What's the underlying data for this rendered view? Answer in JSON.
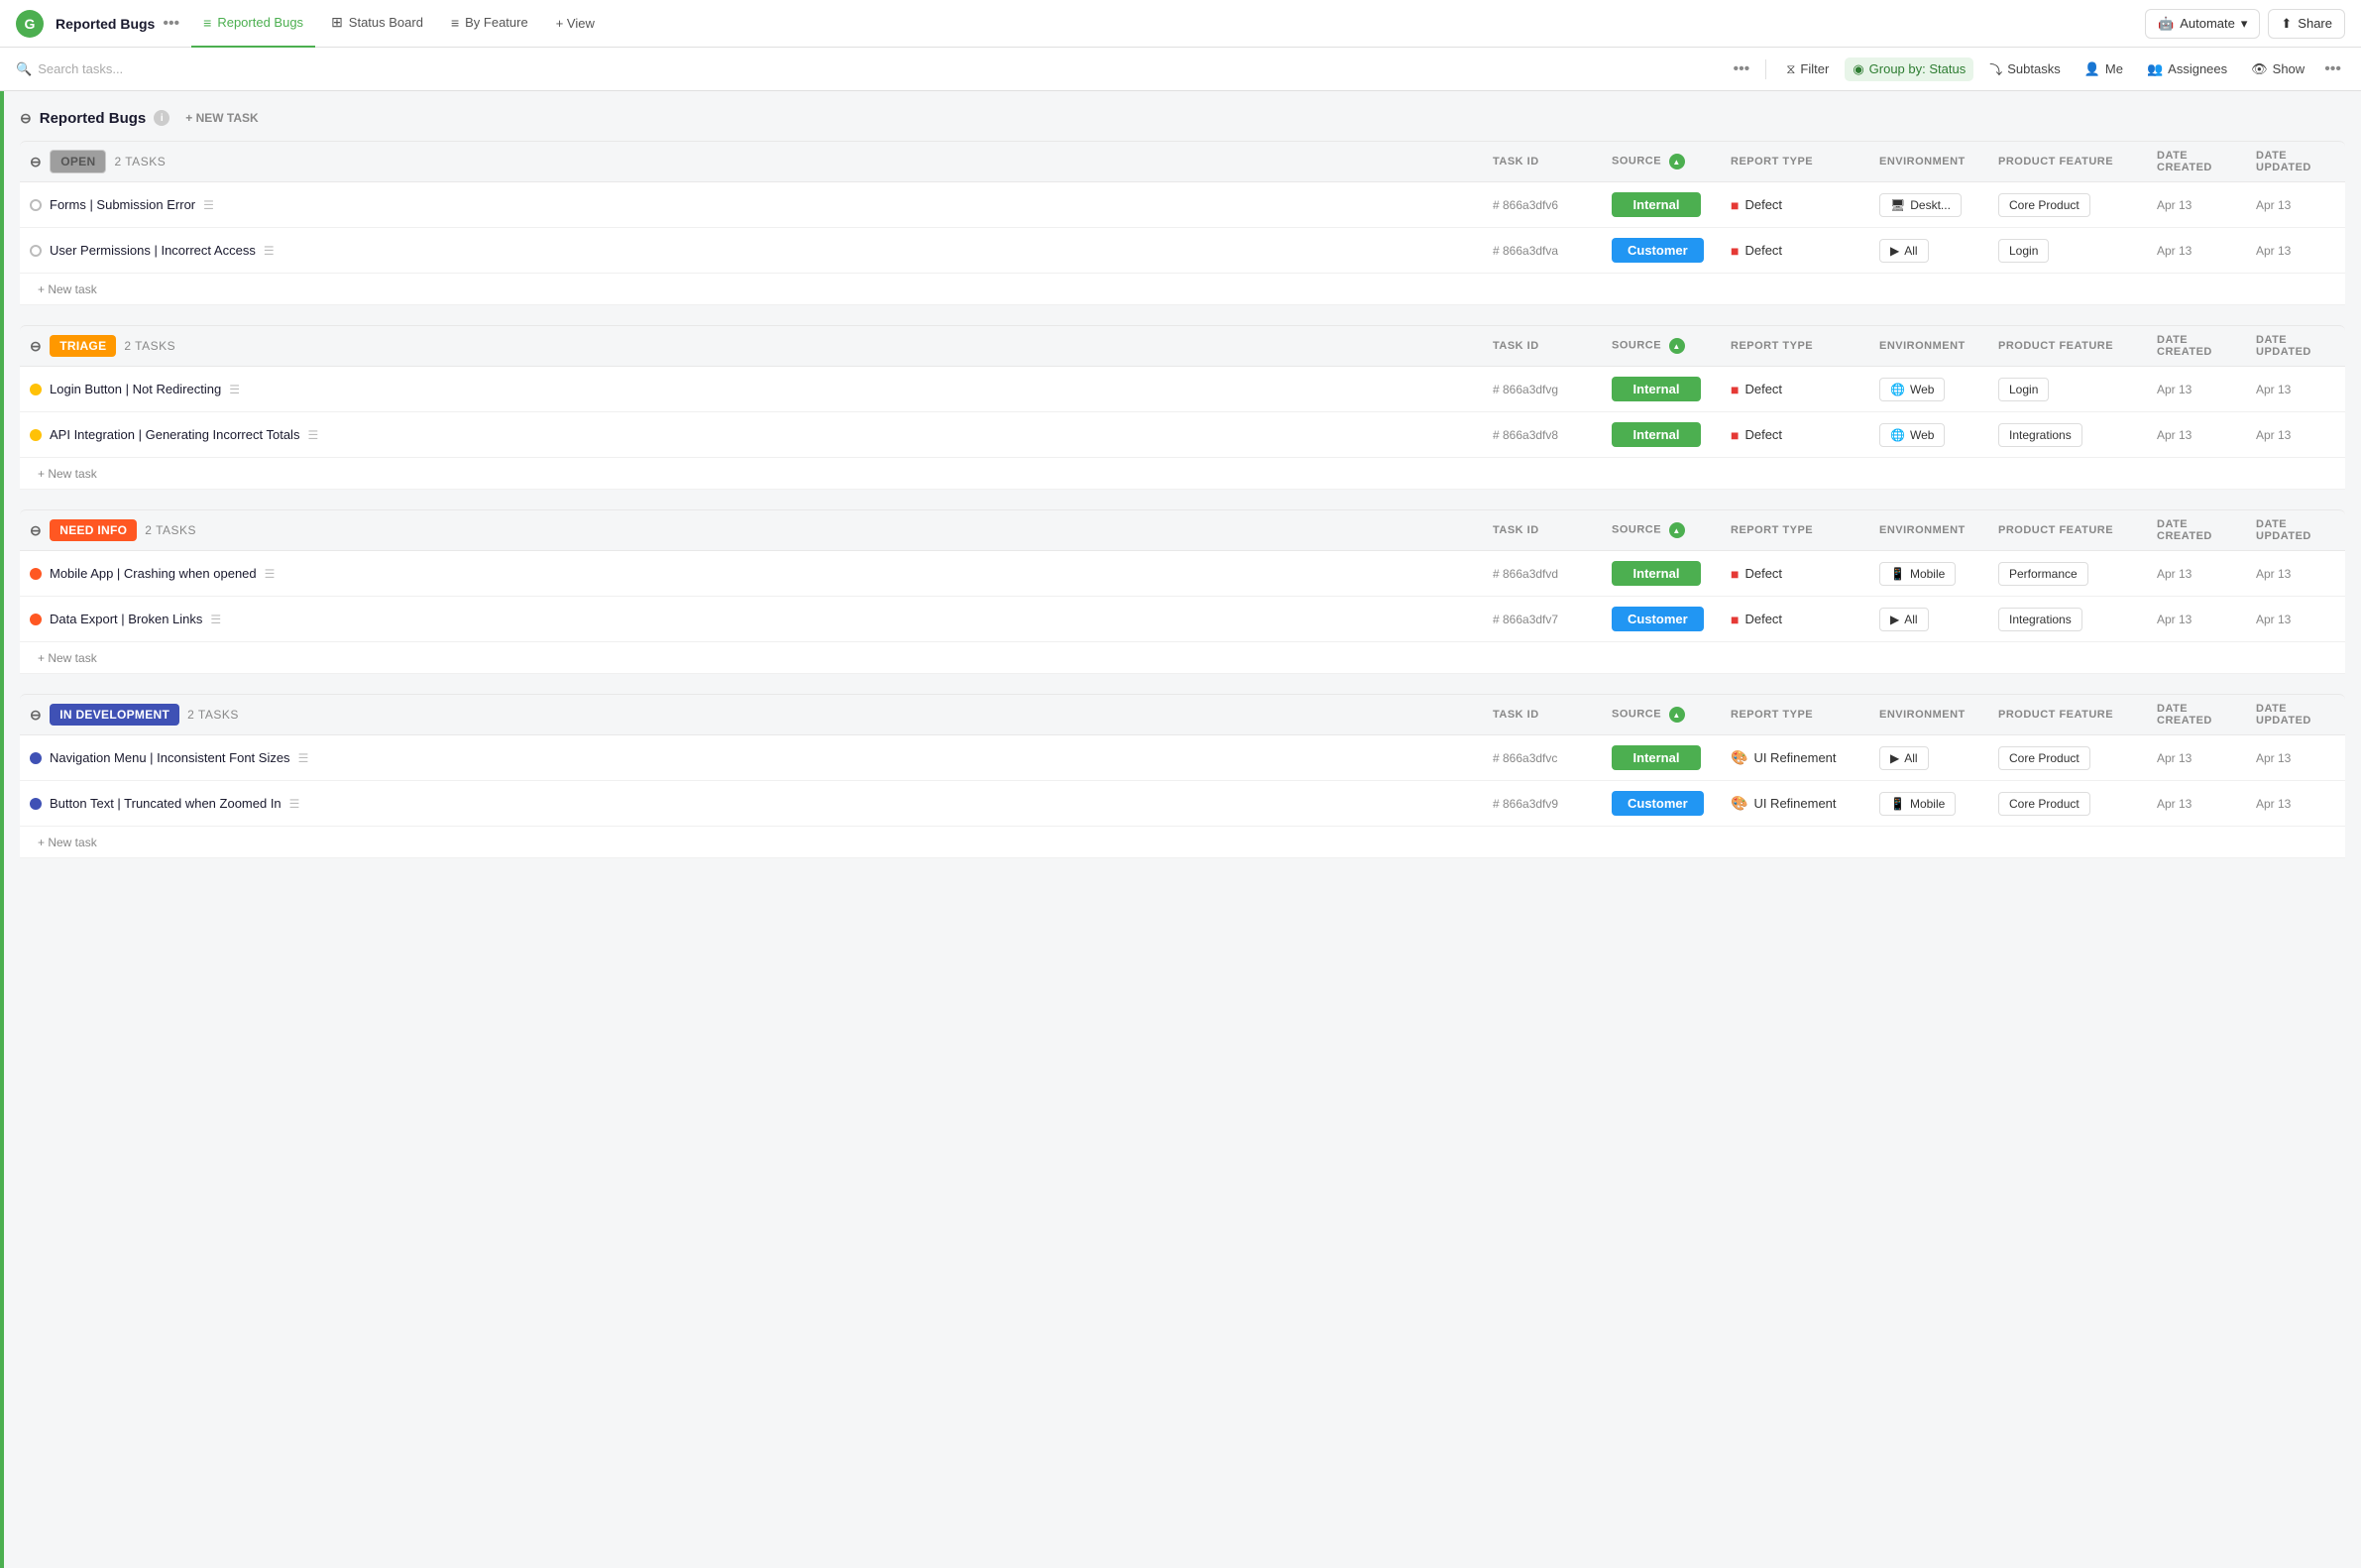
{
  "app": {
    "logo": "G",
    "title": "Reported Bugs",
    "dots_label": "•••"
  },
  "nav": {
    "tabs": [
      {
        "id": "reported-bugs",
        "icon": "≡",
        "label": "Reported Bugs",
        "active": true
      },
      {
        "id": "status-board",
        "icon": "⊞",
        "label": "Status Board",
        "active": false
      },
      {
        "id": "by-feature",
        "icon": "≡",
        "label": "By Feature",
        "active": false
      }
    ],
    "add_view": "+ View"
  },
  "actions": {
    "automate_label": "Automate",
    "share_label": "Share"
  },
  "toolbar": {
    "search_placeholder": "Search tasks...",
    "filter_label": "Filter",
    "group_by_label": "Group by: Status",
    "subtasks_label": "Subtasks",
    "me_label": "Me",
    "assignees_label": "Assignees",
    "show_label": "Show"
  },
  "page": {
    "section_title": "Reported Bugs",
    "new_task_label": "+ NEW TASK",
    "new_task_row": "+ New task"
  },
  "columns": {
    "task_id": "TASK ID",
    "source": "SOURCE",
    "report_type": "REPORT TYPE",
    "environment": "ENVIRONMENT",
    "product_feature": "PRODUCT FEATURE",
    "date_created": "DATE CREATED",
    "date_updated": "DATE UPDATED"
  },
  "groups": [
    {
      "id": "open",
      "status_label": "OPEN",
      "status_class": "status-open",
      "task_count": "2 TASKS",
      "chevron": "⊖",
      "tasks": [
        {
          "dot_class": "dot-gray",
          "name": "Forms | Submission Error",
          "task_id": "# 866a3dfv6",
          "source": "Internal",
          "source_class": "source-internal",
          "report_icon": "🟥",
          "report_type": "Defect",
          "env_icon": "🖥",
          "environment": "Deskt...",
          "feature": "Core Product",
          "date_created": "Apr 13",
          "date_updated": "Apr 13"
        },
        {
          "dot_class": "dot-gray",
          "name": "User Permissions | Incorrect Access",
          "task_id": "# 866a3dfva",
          "source": "Customer",
          "source_class": "source-customer",
          "report_icon": "🟥",
          "report_type": "Defect",
          "env_icon": "▶",
          "environment": "All",
          "feature": "Login",
          "date_created": "Apr 13",
          "date_updated": "Apr 13"
        }
      ]
    },
    {
      "id": "triage",
      "status_label": "TRIAGE",
      "status_class": "status-triage",
      "task_count": "2 TASKS",
      "chevron": "⊖",
      "tasks": [
        {
          "dot_class": "dot-yellow",
          "name": "Login Button | Not Redirecting",
          "task_id": "# 866a3dfvg",
          "source": "Internal",
          "source_class": "source-internal",
          "report_icon": "🟥",
          "report_type": "Defect",
          "env_icon": "🌐",
          "environment": "Web",
          "feature": "Login",
          "date_created": "Apr 13",
          "date_updated": "Apr 13"
        },
        {
          "dot_class": "dot-yellow",
          "name": "API Integration | Generating Incorrect Totals",
          "task_id": "# 866a3dfv8",
          "source": "Internal",
          "source_class": "source-internal",
          "report_icon": "🟥",
          "report_type": "Defect",
          "env_icon": "🌐",
          "environment": "Web",
          "feature": "Integrations",
          "date_created": "Apr 13",
          "date_updated": "Apr 13"
        }
      ]
    },
    {
      "id": "need-info",
      "status_label": "NEED INFO",
      "status_class": "status-need-info",
      "task_count": "2 TASKS",
      "chevron": "⊖",
      "tasks": [
        {
          "dot_class": "dot-orange",
          "name": "Mobile App | Crashing when opened",
          "task_id": "# 866a3dfvd",
          "source": "Internal",
          "source_class": "source-internal",
          "report_icon": "🟥",
          "report_type": "Defect",
          "env_icon": "📱",
          "environment": "Mobile",
          "feature": "Performance",
          "date_created": "Apr 13",
          "date_updated": "Apr 13"
        },
        {
          "dot_class": "dot-orange",
          "name": "Data Export | Broken Links",
          "task_id": "# 866a3dfv7",
          "source": "Customer",
          "source_class": "source-customer",
          "report_icon": "🟥",
          "report_type": "Defect",
          "env_icon": "▶",
          "environment": "All",
          "feature": "Integrations",
          "date_created": "Apr 13",
          "date_updated": "Apr 13"
        }
      ]
    },
    {
      "id": "in-development",
      "status_label": "IN DEVELOPMENT",
      "status_class": "status-in-development",
      "task_count": "2 TASKS",
      "chevron": "⊖",
      "tasks": [
        {
          "dot_class": "dot-blue",
          "name": "Navigation Menu | Inconsistent Font Sizes",
          "task_id": "# 866a3dfvc",
          "source": "Internal",
          "source_class": "source-internal",
          "report_icon": "🎨",
          "report_type": "UI Refinement",
          "env_icon": "▶",
          "environment": "All",
          "feature": "Core Product",
          "date_created": "Apr 13",
          "date_updated": "Apr 13"
        },
        {
          "dot_class": "dot-blue",
          "name": "Button Text | Truncated when Zoomed In",
          "task_id": "# 866a3dfv9",
          "source": "Customer",
          "source_class": "source-customer",
          "report_icon": "🎨",
          "report_type": "UI Refinement",
          "env_icon": "📱",
          "environment": "Mobile",
          "feature": "Core Product",
          "date_created": "Apr 13",
          "date_updated": "Apr 13"
        }
      ]
    }
  ]
}
